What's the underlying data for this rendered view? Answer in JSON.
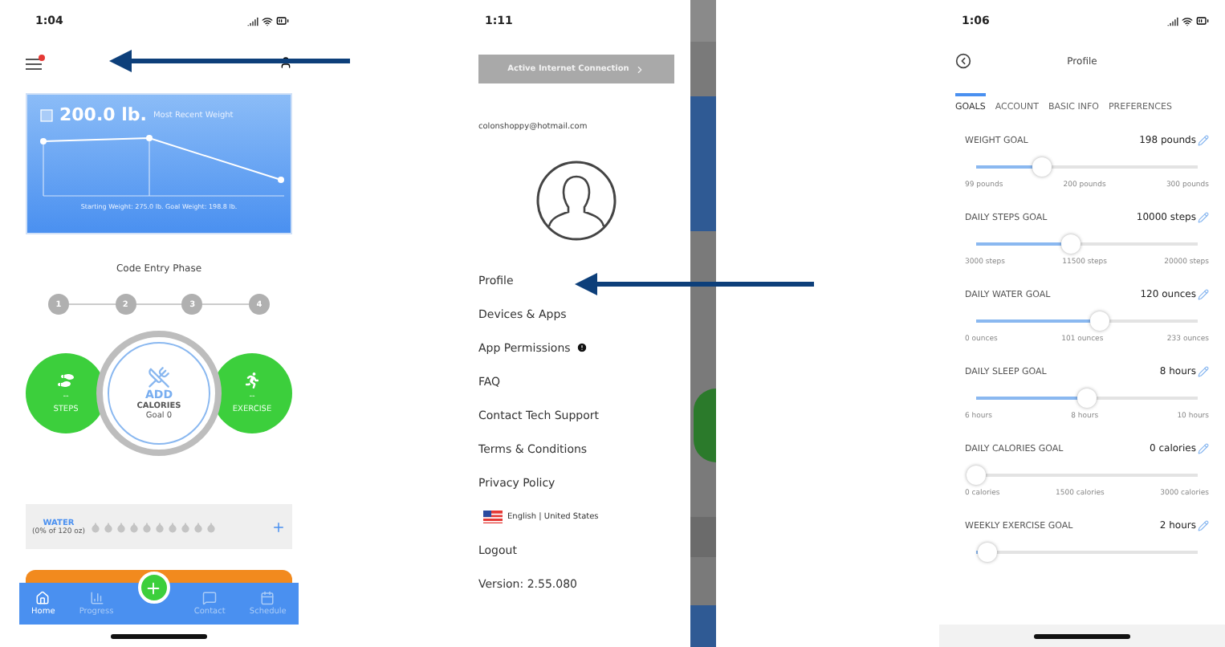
{
  "home": {
    "time": "1:04",
    "weight_card": {
      "value": "200.0 lb.",
      "label": "Most Recent Weight",
      "caption": "Starting Weight: 275.0 lb. Goal Weight: 198.8 lb."
    },
    "phase": {
      "title": "Code Entry Phase",
      "steps": [
        "1",
        "2",
        "3",
        "4"
      ]
    },
    "activity": {
      "steps": {
        "value": "--",
        "label": "STEPS"
      },
      "calories": {
        "action": "ADD",
        "label": "CALORIES",
        "goal": "Goal 0"
      },
      "exercise": {
        "value": "--",
        "label": "EXERCISE"
      }
    },
    "water": {
      "title": "WATER",
      "amount": "(0% of 120 oz)"
    },
    "tab_bar": [
      {
        "kind": "home",
        "label": "Home",
        "selected": true
      },
      {
        "kind": "progress",
        "label": "Progress",
        "selected": false
      },
      {
        "kind": "add"
      },
      {
        "kind": "contact",
        "label": "Contact",
        "selected": false
      },
      {
        "kind": "schedule",
        "label": "Schedule",
        "selected": false
      }
    ]
  },
  "menu": {
    "time": "1:11",
    "connection_button": "Active Internet Connection",
    "email": "colonshoppy@hotmail.com",
    "items": [
      {
        "label": "Profile",
        "kind": "plain"
      },
      {
        "label": "Devices & Apps",
        "kind": "plain"
      },
      {
        "label": "App Permissions",
        "kind": "alert"
      },
      {
        "label": "FAQ",
        "kind": "plain"
      },
      {
        "label": "Contact Tech Support",
        "kind": "plain"
      },
      {
        "label": "Terms & Conditions",
        "kind": "plain"
      },
      {
        "label": "Privacy Policy",
        "kind": "plain"
      }
    ],
    "language": "English | United States",
    "logout": "Logout",
    "version": "Version: 2.55.080"
  },
  "profile": {
    "time": "1:06",
    "title": "Profile",
    "tabs": [
      {
        "label": "GOALS",
        "selected": true
      },
      {
        "label": "ACCOUNT",
        "selected": false
      },
      {
        "label": "BASIC INFO",
        "selected": false
      },
      {
        "label": "PREFERENCES",
        "selected": false
      }
    ],
    "goals": [
      {
        "title": "WEIGHT GOAL",
        "value": "198 pounds",
        "level": 0.3,
        "ticks": [
          "99 pounds",
          "200 pounds",
          "300 pounds"
        ]
      },
      {
        "title": "DAILY STEPS GOAL",
        "value": "10000 steps",
        "level": 0.43,
        "ticks": [
          "3000 steps",
          "11500 steps",
          "20000 steps"
        ]
      },
      {
        "title": "DAILY WATER GOAL",
        "value": "120 ounces",
        "level": 0.56,
        "ticks": [
          "0 ounces",
          "101 ounces",
          "233 ounces"
        ]
      },
      {
        "title": "DAILY SLEEP GOAL",
        "value": "8 hours",
        "level": 0.5,
        "ticks": [
          "6 hours",
          "8 hours",
          "10 hours"
        ]
      },
      {
        "title": "DAILY CALORIES GOAL",
        "value": "0 calories",
        "level": 0.0,
        "ticks": [
          "0 calories",
          "1500 calories",
          "3000 calories"
        ]
      },
      {
        "title": "WEEKLY EXERCISE GOAL",
        "value": "2 hours",
        "level": 0.05
      }
    ]
  }
}
